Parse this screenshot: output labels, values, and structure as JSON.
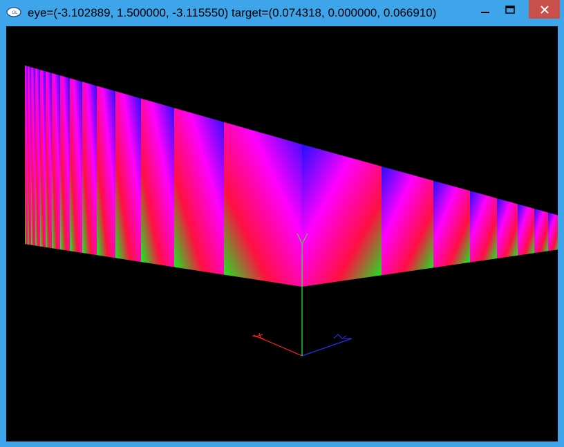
{
  "window": {
    "title": "eye=(-3.102889, 1.500000, -3.115550) target=(0.074318, 0.000000, 0.066910)",
    "app_icon": "freeglut-icon",
    "app_icon_label": "GL",
    "frame_color": "#3ea5ea",
    "close_color": "#c7504a",
    "controls": {
      "minimize": "minimize-icon",
      "maximize": "maximize-icon",
      "close": "close-icon"
    }
  },
  "viewport": {
    "background": "#000000",
    "scene": "row of RGB-gradient cube faces with origin axes",
    "axis_colors": {
      "x": "#ff2020",
      "y": "#20ff20",
      "z": "#3030ff"
    },
    "axis_labels": [
      "X",
      "Y",
      "Z"
    ]
  }
}
